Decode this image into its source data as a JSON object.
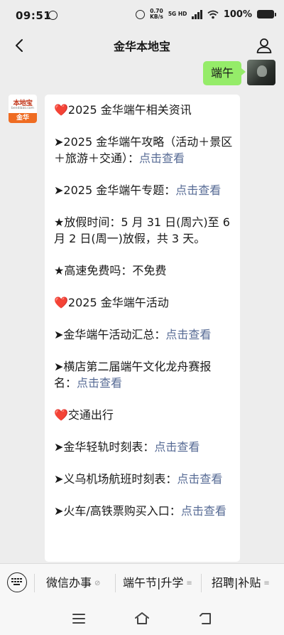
{
  "status_bar": {
    "time": "09:51",
    "net_speed_value": "0.70",
    "net_speed_unit": "KB/s",
    "network": "5G HD",
    "battery": "100%"
  },
  "nav": {
    "title": "金华本地宝",
    "back_icon": "chevron-left-icon",
    "profile_icon": "person-icon"
  },
  "sent_message": {
    "text": "端午"
  },
  "bot": {
    "avatar_top": "本地宝",
    "avatar_sub": "bendibao.com",
    "avatar_band": "金华"
  },
  "message": {
    "p1_icon": "❤️",
    "p1_text": "2025 金华端午相关资讯",
    "p2_icon": "➤",
    "p2_text": "2025 金华端午攻略（活动＋景区＋旅游＋交通）：",
    "p2_link": "点击查看",
    "p3_icon": "➤",
    "p3_text": "2025 金华端午专题：",
    "p3_link": "点击查看",
    "p4_icon": "★",
    "p4_text": "放假时间：5 月 31 日(周六)至 6 月 2 日(周一)放假，共 3 天。",
    "p5_icon": "★",
    "p5_text": "高速免费吗：不免费",
    "p6_icon": "❤️",
    "p6_text": "2025 金华端午活动",
    "p7_icon": "➤",
    "p7_text": "金华端午活动汇总：",
    "p7_link": "点击查看",
    "p8_icon": "➤",
    "p8_text": "横店第二届端午文化龙舟赛报名：",
    "p8_link": "点击查看",
    "p9_icon": "❤️",
    "p9_text": "交通出行",
    "p10_icon": "➤",
    "p10_text": "金华轻轨时刻表：",
    "p10_link": "点击查看",
    "p11_icon": "➤",
    "p11_text": "义乌机场航班时刻表：",
    "p11_link": "点击查看",
    "p12_icon": "➤",
    "p12_text": "火车/高铁票购买入口：",
    "p12_link": "点击查看"
  },
  "bottom_menu": {
    "keyboard_icon": "keyboard-icon",
    "item1": "微信办事",
    "item1_mark": "⊘",
    "item2": "端午节|升学",
    "item2_mark": "≡",
    "item3": "招聘|补贴",
    "item3_mark": "≡"
  },
  "system_nav": {
    "menu_icon": "menu-icon",
    "home_icon": "home-icon",
    "back_icon": "back-icon"
  },
  "colors": {
    "sent_bubble": "#95ec69",
    "link": "#576b95",
    "heart": "#e0272b",
    "background": "#ededed"
  }
}
